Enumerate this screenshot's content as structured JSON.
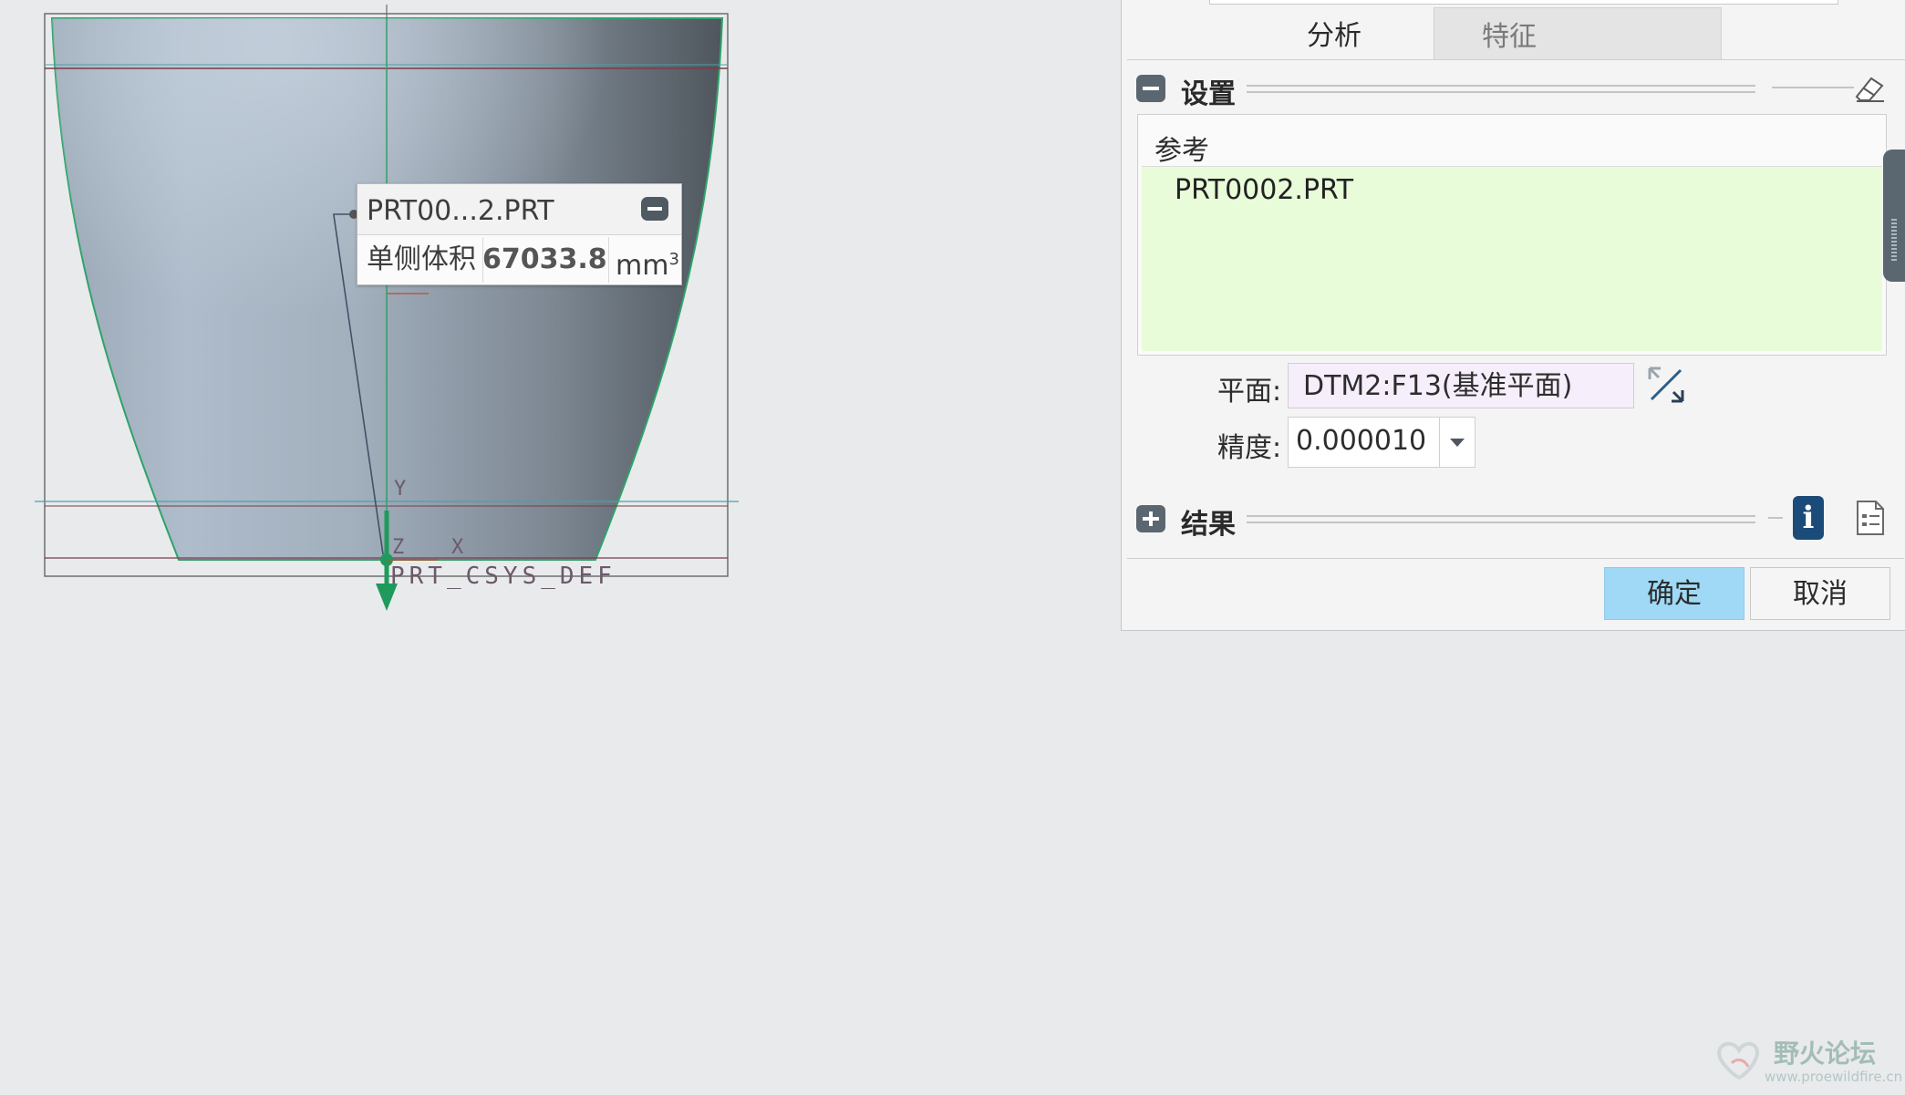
{
  "viewport": {
    "csys_label": "PRT_CSYS_DEF",
    "axis_labels": {
      "y": "Y",
      "z": "Z",
      "x": "X"
    }
  },
  "callout": {
    "title": "PRT00...2.PRT",
    "metric_label": "单侧体积",
    "metric_value": "67033.8",
    "unit": "mm",
    "unit_exp": "3"
  },
  "dialog": {
    "tabs": [
      "分析",
      "特征"
    ],
    "active_tab": "分析",
    "settings_section": "设置",
    "references_header": "参考",
    "references": [
      "PRT0002.PRT"
    ],
    "plane_label": "平面:",
    "plane_value": "DTM2:F13(基准平面)",
    "precision_label": "精度:",
    "precision_value": "0.000010",
    "results_section": "结果",
    "ok_label": "确定",
    "cancel_label": "取消"
  },
  "watermark": {
    "name": "野火论坛",
    "url": "www.proewildfire.cn"
  },
  "colors": {
    "background": "#e9eaec",
    "selection_green": "#e9fcd9",
    "ok_button": "#9fd9f6",
    "plane_field": "#f6eefb",
    "model_edge": "#2a9d5a"
  }
}
